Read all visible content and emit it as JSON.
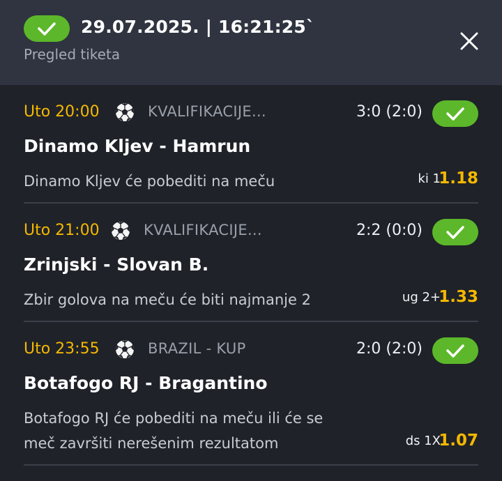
{
  "header": {
    "datetime": "29.07.2025. | 16:21:25`",
    "subtitle": "Pregled tiketa",
    "status_icon": "check-icon",
    "close_icon": "close-icon",
    "accent": "#5cb82a"
  },
  "bets": [
    {
      "time": "Uto 20:00",
      "sport_icon": "soccer-ball-icon",
      "league": "KVALIFIKACIJE...",
      "score": "3:0 (2:0)",
      "match": "Dinamo Kljev - Hamrun",
      "description": "Dinamo Kljev će pobediti na meču",
      "pick": "ki 1",
      "odds": "1.18",
      "status": "won"
    },
    {
      "time": "Uto 21:00",
      "sport_icon": "soccer-ball-icon",
      "league": "KVALIFIKACIJE...",
      "score": "2:2 (0:0)",
      "match": "Zrinjski - Slovan B.",
      "description": "Zbir golova na meču će biti najmanje 2",
      "pick": "ug 2+",
      "odds": "1.33",
      "status": "won"
    },
    {
      "time": "Uto 23:55",
      "sport_icon": "soccer-ball-icon",
      "league": "BRAZIL - KUP",
      "score": "2:0 (2:0)",
      "match": "Botafogo RJ - Bragantino",
      "description_line1": "Botafogo RJ će pobediti na meču ili će se",
      "description_line2": "meč završiti nerešenim rezultatom",
      "pick": "ds 1X",
      "odds": "1.07",
      "status": "won"
    }
  ]
}
